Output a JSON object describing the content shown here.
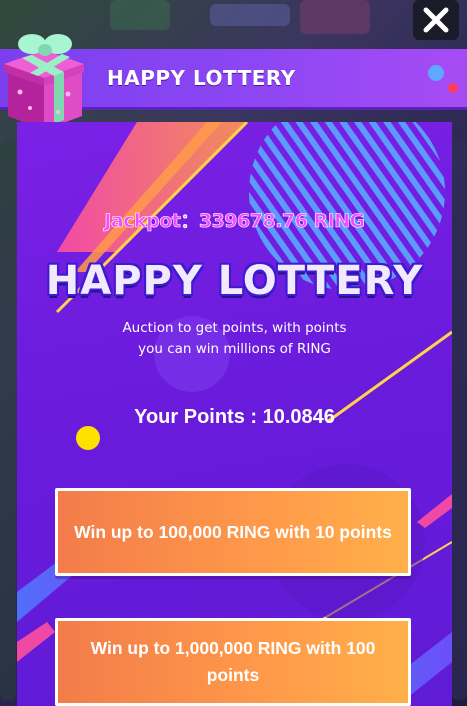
{
  "window": {
    "close_icon": "close-x-icon"
  },
  "header": {
    "title": "HAPPY LOTTERY",
    "icon": "gift-box-icon"
  },
  "lottery": {
    "jackpot": "Jackpot：339678.76 RING",
    "title": "HAPPY LOTTERY",
    "subtitle_line1": "Auction to get points,  with points",
    "subtitle_line2": "you can win millions of RING",
    "points": "Your Points : 10.0846"
  },
  "offers": [
    {
      "label": "Win up to 100,000 RING with 10 points"
    },
    {
      "label": "Win up to 1,000,000 RING with 100 points"
    }
  ],
  "colors": {
    "panel": "#6a1bdc",
    "header": "#8d46f3",
    "jackpot": "#f14cff",
    "button": "#ff9a4a"
  }
}
